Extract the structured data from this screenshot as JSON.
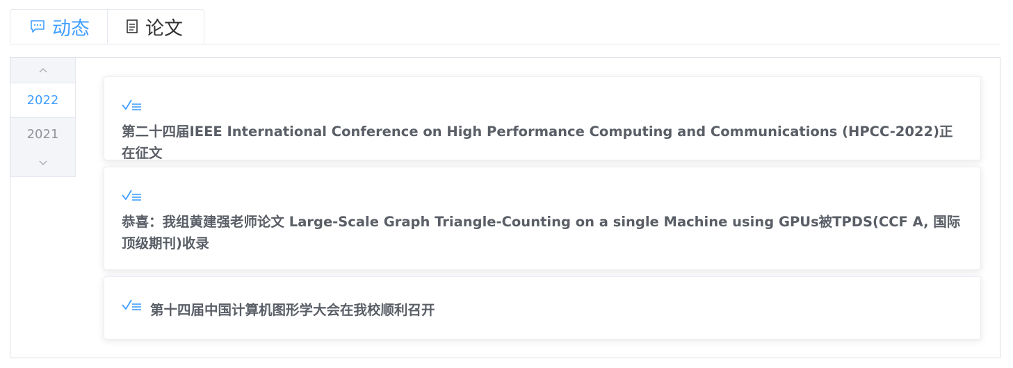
{
  "tabs": [
    {
      "label": "动态",
      "icon": "chat-icon",
      "active": true
    },
    {
      "label": "论文",
      "icon": "document-icon",
      "active": false
    }
  ],
  "years": {
    "items": [
      "2022",
      "2021"
    ],
    "selected": "2022"
  },
  "news": [
    {
      "title": "第二十四届IEEE International Conference on High Performance Computing and Communications (HPCC-2022)正在征文",
      "icon": "check-list-icon"
    },
    {
      "title": "恭喜：我组黄建强老师论文 Large-Scale Graph Triangle-Counting on a single Machine using GPUs被TPDS(CCF A, 国际顶级期刊)收录",
      "icon": "check-list-icon"
    },
    {
      "title": "第十四届中国计算机图形学大会在我校顺利召开",
      "icon": "check-list-icon"
    }
  ],
  "colors": {
    "accent": "#409eff",
    "title_text": "#5a5e66",
    "muted": "#909399"
  }
}
